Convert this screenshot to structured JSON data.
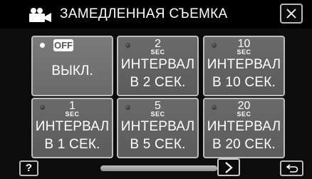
{
  "header": {
    "title": "ЗАМЕДЛЕННАЯ СЪЕМКА",
    "icon": "video-camera-icon",
    "close_icon": "close-icon"
  },
  "tiles": [
    {
      "id": "off",
      "badge": "OFF",
      "label": "ВЫКЛ.",
      "selected": true
    },
    {
      "id": "2",
      "num": "2",
      "unit": "SEC",
      "line1": "ИНТЕРВАЛ",
      "line2": "В 2 СЕК.",
      "selected": false
    },
    {
      "id": "10",
      "num": "10",
      "unit": "SEC",
      "line1": "ИНТЕРВАЛ",
      "line2": "В 10 СЕК.",
      "selected": false
    },
    {
      "id": "1",
      "num": "1",
      "unit": "SEC",
      "line1": "ИНТЕРВАЛ",
      "line2": "В 1 СЕК.",
      "selected": false
    },
    {
      "id": "5",
      "num": "5",
      "unit": "SEC",
      "line1": "ИНТЕРВАЛ",
      "line2": "В 5 СЕК.",
      "selected": false
    },
    {
      "id": "20",
      "num": "20",
      "unit": "SEC",
      "line1": "ИНТЕРВАЛ",
      "line2": "В 20 СЕК.",
      "selected": false
    }
  ],
  "footer": {
    "help_label": "?",
    "next_icon": "chevron-right-icon",
    "back_icon": "return-arrow-icon",
    "scroll_icon": "scrollbar"
  },
  "colors": {
    "background": "#0c0c0c",
    "tile": "#636363",
    "tile_border": "#bdbdbd",
    "text": "#ffffff"
  }
}
